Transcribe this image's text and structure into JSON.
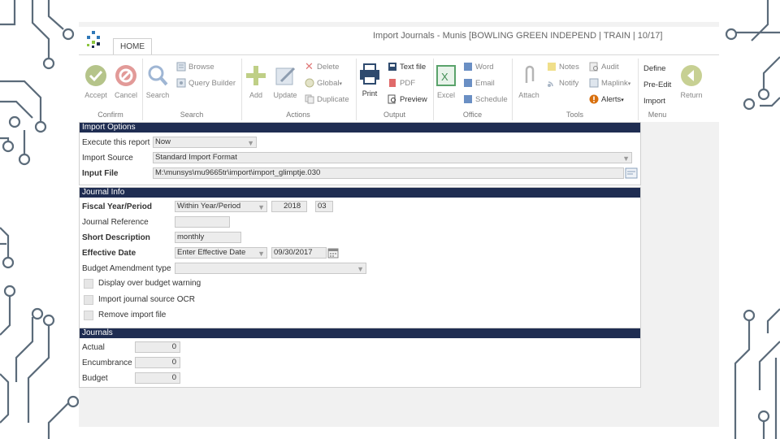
{
  "window": {
    "title": "Import Journals - Munis [BOWLING GREEN INDEPEND | TRAIN | 10/17]",
    "tab": "HOME"
  },
  "ribbon": {
    "confirm": {
      "label": "Confirm",
      "accept": "Accept",
      "cancel": "Cancel"
    },
    "search": {
      "label": "Search",
      "search": "Search",
      "browse": "Browse",
      "query_builder": "Query Builder"
    },
    "actions": {
      "label": "Actions",
      "add": "Add",
      "update": "Update",
      "delete": "Delete",
      "global": "Global",
      "duplicate": "Duplicate"
    },
    "output": {
      "label": "Output",
      "print": "Print",
      "text_file": "Text file",
      "pdf": "PDF",
      "preview": "Preview"
    },
    "office": {
      "label": "Office",
      "excel": "Excel",
      "word": "Word",
      "email": "Email",
      "schedule": "Schedule"
    },
    "tools": {
      "label": "Tools",
      "attach": "Attach",
      "notes": "Notes",
      "notify": "Notify",
      "audit": "Audit",
      "maplink": "Maplink",
      "alerts": "Alerts"
    },
    "menu": {
      "label": "Menu",
      "define": "Define",
      "pre_edit": "Pre-Edit",
      "import": "Import",
      "return": "Return"
    }
  },
  "import_options": {
    "header": "Import Options",
    "execute_label": "Execute this report",
    "execute_value": "Now",
    "source_label": "Import Source",
    "source_value": "Standard Import Format",
    "file_label": "Input File",
    "file_value": "M:\\munsys\\mu9665tr\\import\\import_glimptje.030"
  },
  "journal_info": {
    "header": "Journal Info",
    "fiscal_label": "Fiscal Year/Period",
    "fiscal_mode": "Within Year/Period",
    "fiscal_year": "2018",
    "fiscal_period": "03",
    "reference_label": "Journal Reference",
    "reference_value": "",
    "short_desc_label": "Short Description",
    "short_desc_value": "monthly",
    "eff_date_label": "Effective Date",
    "eff_date_mode": "Enter Effective Date",
    "eff_date_value": "09/30/2017",
    "budget_type_label": "Budget Amendment type",
    "budget_type_value": "",
    "chk_budget_warning": "Display over budget warning",
    "chk_source_ocr": "Import journal source OCR",
    "chk_remove_file": "Remove import file"
  },
  "journals": {
    "header": "Journals",
    "actual_label": "Actual",
    "actual_value": "0",
    "encumbrance_label": "Encumbrance",
    "encumbrance_value": "0",
    "budget_label": "Budget",
    "budget_value": "0"
  }
}
